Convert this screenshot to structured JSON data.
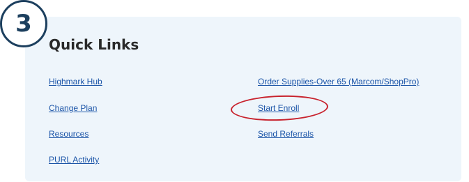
{
  "step": {
    "number": "3"
  },
  "quick_links": {
    "title": "Quick Links",
    "left_column": [
      {
        "label": "Highmark Hub"
      },
      {
        "label": "Change Plan"
      },
      {
        "label": "Resources"
      },
      {
        "label": "PURL Activity"
      }
    ],
    "right_column": [
      {
        "label": "Order Supplies-Over 65 (Marcom/ShopPro)"
      },
      {
        "label": "Start Enroll"
      },
      {
        "label": "Send Referrals"
      }
    ]
  },
  "colors": {
    "panel_background": "#eef5fb",
    "link": "#1c55a8",
    "highlight": "#c8222d",
    "badge_border": "#1c3f5e"
  }
}
